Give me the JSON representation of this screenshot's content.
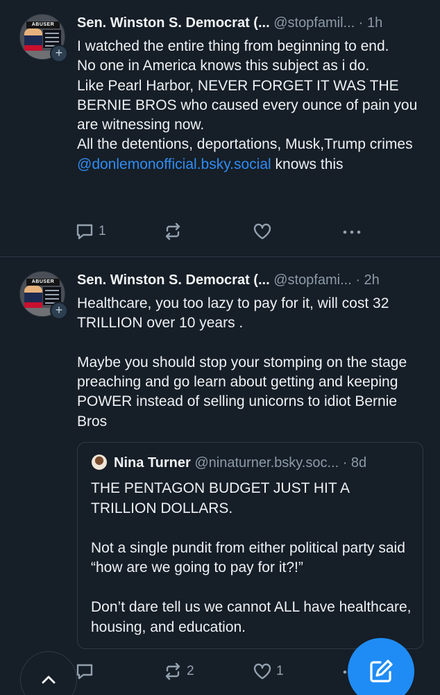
{
  "posts": [
    {
      "display_name": "Sen. Winston S. Democrat (...",
      "handle": "@stopfamil...",
      "time": "· 1h",
      "avatar_banner": "ABUSER",
      "body_lines": [
        "I watched the entire thing from beginning to end.",
        "No one in America knows this subject as i do.",
        "Like Pearl Harbor, NEVER FORGET IT WAS THE BERNIE BROS who caused every ounce of pain you are witnessing now.",
        "All the detentions, deportations, Musk,Trump crimes"
      ],
      "mention": "@donlemonofficial.bsky.social",
      "mention_suffix": " knows this",
      "reply_count": "1",
      "repost_count": "",
      "like_count": ""
    },
    {
      "display_name": "Sen. Winston S. Democrat (...",
      "handle": "@stopfami...",
      "time": "· 2h",
      "avatar_banner": "ABUSER",
      "paragraphs": [
        "Healthcare, you too lazy to pay for it, will cost 32 TRILLION over 10 years .",
        "Maybe you should stop your stomping on the stage preaching and go learn about getting and keeping POWER instead of selling unicorns to idiot Bernie Bros"
      ],
      "quote": {
        "display_name": "Nina Turner",
        "handle": "@ninaturner.bsky.soc...",
        "time": "· 8d",
        "paragraphs": [
          "THE PENTAGON BUDGET JUST HIT A TRILLION DOLLARS.",
          "Not a single pundit from either political party said “how are we going to pay for it?!”",
          "Don’t dare tell us we cannot ALL have healthcare, housing, and education."
        ]
      },
      "reply_count": "",
      "repost_count": "2",
      "like_count": "1"
    }
  ],
  "colors": {
    "background": "#161e27",
    "accent": "#1f8cf5",
    "mention": "#2f8df2",
    "muted": "#8c9aa8"
  },
  "icons": {
    "reply": "speech-bubble-icon",
    "repost": "repost-arrows-icon",
    "like": "heart-icon",
    "more": "ellipsis-icon",
    "scroll_top": "chevron-up-icon",
    "compose": "compose-pencil-icon"
  }
}
